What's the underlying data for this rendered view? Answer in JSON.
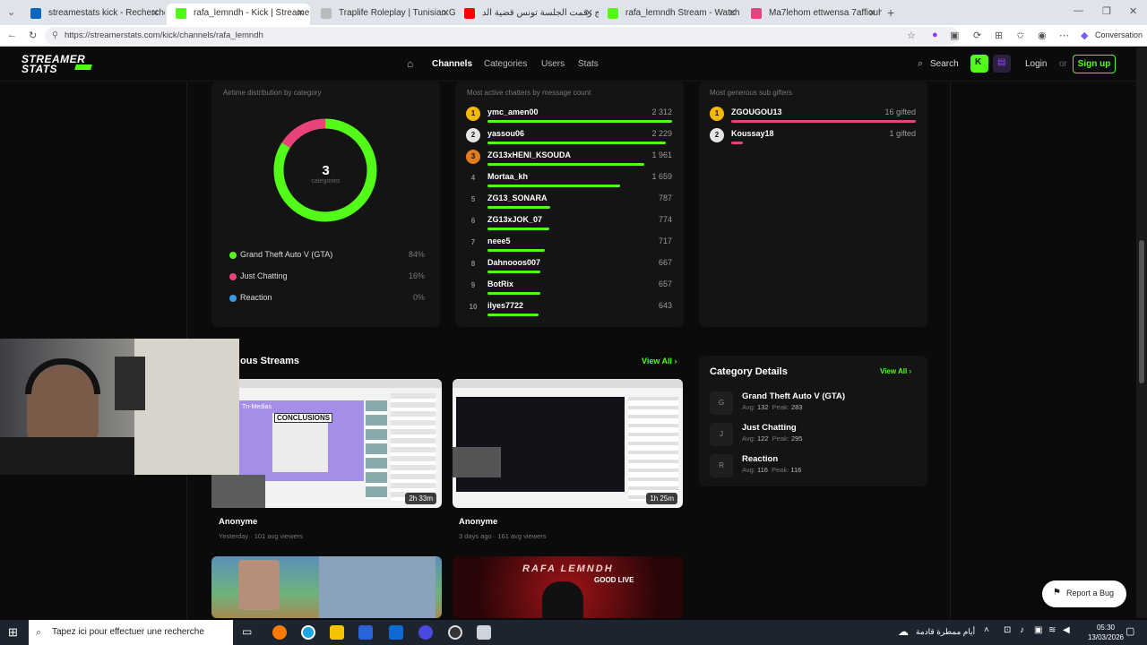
{
  "browser": {
    "tabs": [
      {
        "label": "streamestats kick - Recherche",
        "color": "#0a66c2"
      },
      {
        "label": "rafa_lemndh - Kick | StreamerStats",
        "color": "#53fc18",
        "active": true
      },
      {
        "label": "Traplife Roleplay | Tunisian GTA V",
        "color": "#bbbbbb"
      },
      {
        "label": "برامج رقمت الجلسة تونس قضية الد",
        "color": "#ff0000"
      },
      {
        "label": "rafa_lemndh Stream - Watch Live",
        "color": "#53fc18"
      },
      {
        "label": "Ma7lehom ettwensa 7affiouha fel",
        "color": "#e0457b"
      }
    ],
    "url": "https://streamerstats.com/kick/channels/rafa_lemndh",
    "conversation_label": "Conversation"
  },
  "site": {
    "logo_line1": "STREAMER",
    "logo_line2": "STATS",
    "nav": {
      "channels": "Channels",
      "categories": "Categories",
      "users": "Users",
      "stats": "Stats"
    },
    "search_label": "Search",
    "login_label": "Login",
    "or_label": "or",
    "signup_label": "Sign up"
  },
  "airtime": {
    "subtitle": "Airtime distribution by category",
    "count": "3",
    "count_label": "categories",
    "items": [
      {
        "label": "Grand Theft Auto V (GTA)",
        "pct": "84%",
        "value": 84,
        "color": "#53fc18"
      },
      {
        "label": "Just Chatting",
        "pct": "16%",
        "value": 16,
        "color": "#e8447a"
      },
      {
        "label": "Reaction",
        "pct": "0%",
        "value": 0,
        "color": "#3b9ae1"
      }
    ]
  },
  "chatters": {
    "subtitle": "Most active chatters by message count",
    "items": [
      {
        "rank": "1",
        "name": "ymc_amen00",
        "count": "2 312",
        "value": 2312
      },
      {
        "rank": "2",
        "name": "yassou06",
        "count": "2 229",
        "value": 2229
      },
      {
        "rank": "3",
        "name": "ZG13xHENI_KSOUDA",
        "count": "1 961",
        "value": 1961
      },
      {
        "rank": "4",
        "name": "Mortaa_kh",
        "count": "1 659",
        "value": 1659
      },
      {
        "rank": "5",
        "name": "ZG13_SONARA",
        "count": "787",
        "value": 787
      },
      {
        "rank": "6",
        "name": "ZG13xJOK_07",
        "count": "774",
        "value": 774
      },
      {
        "rank": "7",
        "name": "neee5",
        "count": "717",
        "value": 717
      },
      {
        "rank": "8",
        "name": "Dahnooos007",
        "count": "667",
        "value": 667
      },
      {
        "rank": "9",
        "name": "BotRix",
        "count": "657",
        "value": 657
      },
      {
        "rank": "10",
        "name": "ilyes7722",
        "count": "643",
        "value": 643
      }
    ]
  },
  "gifters": {
    "subtitle": "Most generous sub gifters",
    "items": [
      {
        "rank": "1",
        "name": "ZGOUGOU13",
        "count": "16 gifted",
        "value": 16
      },
      {
        "rank": "2",
        "name": "Koussay18",
        "count": "1 gifted",
        "value": 1
      }
    ]
  },
  "streams": {
    "title": "ous Streams",
    "view_all": "View All",
    "items": [
      {
        "name": "Anonyme",
        "meta": "Yesterday · 101 avg viewers",
        "duration": "2h 33m",
        "thumb_text": "CONCLUSIONS",
        "thumb_sub": "Tn-Medias"
      },
      {
        "name": "Anonyme",
        "meta": "3 days ago · 161 avg viewers",
        "duration": "1h 25m"
      }
    ],
    "banner_text1": "RAFA LEMNDH",
    "banner_text2": "GOOD LIVE"
  },
  "category_details": {
    "title": "Category Details",
    "view_all": "View All",
    "items": [
      {
        "icon": "G",
        "name": "Grand Theft Auto V (GTA)",
        "avg_label": "Avg:",
        "avg": "132",
        "peak_label": "Peak:",
        "peak": "283"
      },
      {
        "icon": "J",
        "name": "Just Chatting",
        "avg_label": "Avg:",
        "avg": "122",
        "peak_label": "Peak:",
        "peak": "295"
      },
      {
        "icon": "R",
        "name": "Reaction",
        "avg_label": "Avg:",
        "avg": "116",
        "peak_label": "Peak:",
        "peak": "116"
      }
    ]
  },
  "report_bug": "Report a Bug",
  "taskbar": {
    "search_placeholder": "Tapez ici pour effectuer une recherche",
    "weather": "أيام ممطرة قادمة",
    "time": "05:30",
    "date": "13/03/2026"
  },
  "colors": {
    "accent": "#53fc18",
    "pink": "#e8447a",
    "gold": "#f5b800",
    "bronze": "#e07b1f"
  }
}
